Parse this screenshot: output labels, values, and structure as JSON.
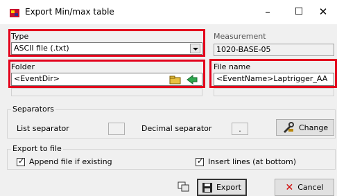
{
  "window": {
    "title": "Export Min/max table",
    "minimize": "–",
    "maximize": "☐",
    "close": "✕"
  },
  "type": {
    "label": "Type",
    "value": "ASCII file (.txt)"
  },
  "measurement": {
    "label": "Measurement",
    "value": "1020-BASE-05"
  },
  "folder": {
    "label": "Folder",
    "value": "<EventDir>"
  },
  "filename": {
    "label": "File name",
    "value": "<EventName>Laptrigger_AA"
  },
  "separators": {
    "title": "Separators",
    "list_label": "List separator",
    "list_value": "",
    "decimal_label": "Decimal separator",
    "decimal_value": ".",
    "change_label": "Change"
  },
  "export_to_file": {
    "title": "Export to file",
    "append_label": "Append file if existing",
    "append_checked": true,
    "insert_label": "Insert lines (at bottom)",
    "insert_checked": true
  },
  "buttons": {
    "export": "Export",
    "cancel": "Cancel"
  },
  "colors": {
    "highlight": "#e3001b",
    "accent": "#0a64ad"
  }
}
